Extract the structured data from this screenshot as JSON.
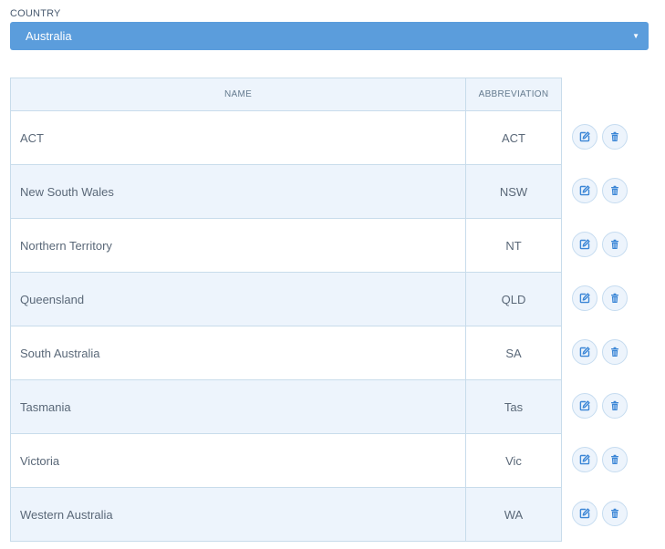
{
  "country": {
    "label": "COUNTRY",
    "selected": "Australia"
  },
  "table": {
    "headers": {
      "name": "NAME",
      "abbreviation": "ABBREVIATION"
    },
    "rows": [
      {
        "name": "ACT",
        "abbreviation": "ACT"
      },
      {
        "name": "New South Wales",
        "abbreviation": "NSW"
      },
      {
        "name": "Northern Territory",
        "abbreviation": "NT"
      },
      {
        "name": "Queensland",
        "abbreviation": "QLD"
      },
      {
        "name": "South Australia",
        "abbreviation": "SA"
      },
      {
        "name": "Tasmania",
        "abbreviation": "Tas"
      },
      {
        "name": "Victoria",
        "abbreviation": "Vic"
      },
      {
        "name": "Western Australia",
        "abbreviation": "WA"
      }
    ]
  },
  "icons": {
    "edit": "edit-icon",
    "delete": "trash-icon",
    "dropdown": "caret-down-icon"
  },
  "colors": {
    "accent": "#5b9ddc",
    "row_alt": "#edf4fc",
    "border": "#c8dceb",
    "icon": "#3b86d6"
  }
}
